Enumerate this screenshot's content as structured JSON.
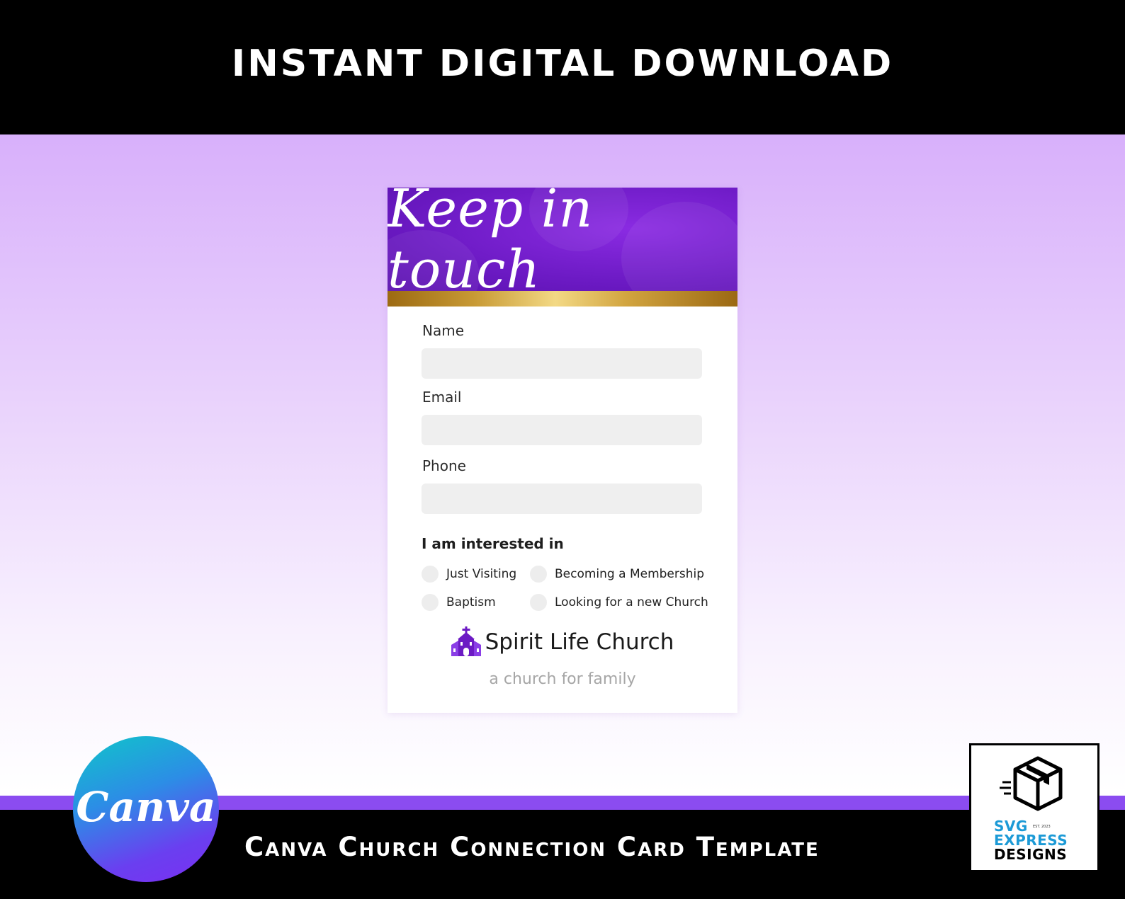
{
  "banner": {
    "top_title": "INSTANT DIGITAL DOWNLOAD",
    "bottom_title": "Canva Church Connection Card Template"
  },
  "card": {
    "header_title": "Keep in touch",
    "fields": [
      {
        "label": "Name",
        "value": ""
      },
      {
        "label": "Email",
        "value": ""
      },
      {
        "label": "Phone",
        "value": ""
      }
    ],
    "interests": {
      "heading": "I am interested in",
      "options": [
        "Just Visiting",
        "Becoming a Membership",
        "Baptism",
        "Looking for a new Church"
      ]
    },
    "church_icon": "church-icon",
    "church_name": "Spirit Life Church",
    "tagline": "a church for family"
  },
  "logos": {
    "canva": "Canva",
    "svg_express": {
      "line1": "SVG",
      "line2": "EXPRESS",
      "line3": "DESIGNS",
      "est": "EST. 2023",
      "icon": "box-icon"
    }
  },
  "colors": {
    "header_purple": "#6c1ac4",
    "gold": "#d2a540",
    "stripe_purple": "#8b4cf0",
    "svg_blue": "#1c9ad6"
  }
}
